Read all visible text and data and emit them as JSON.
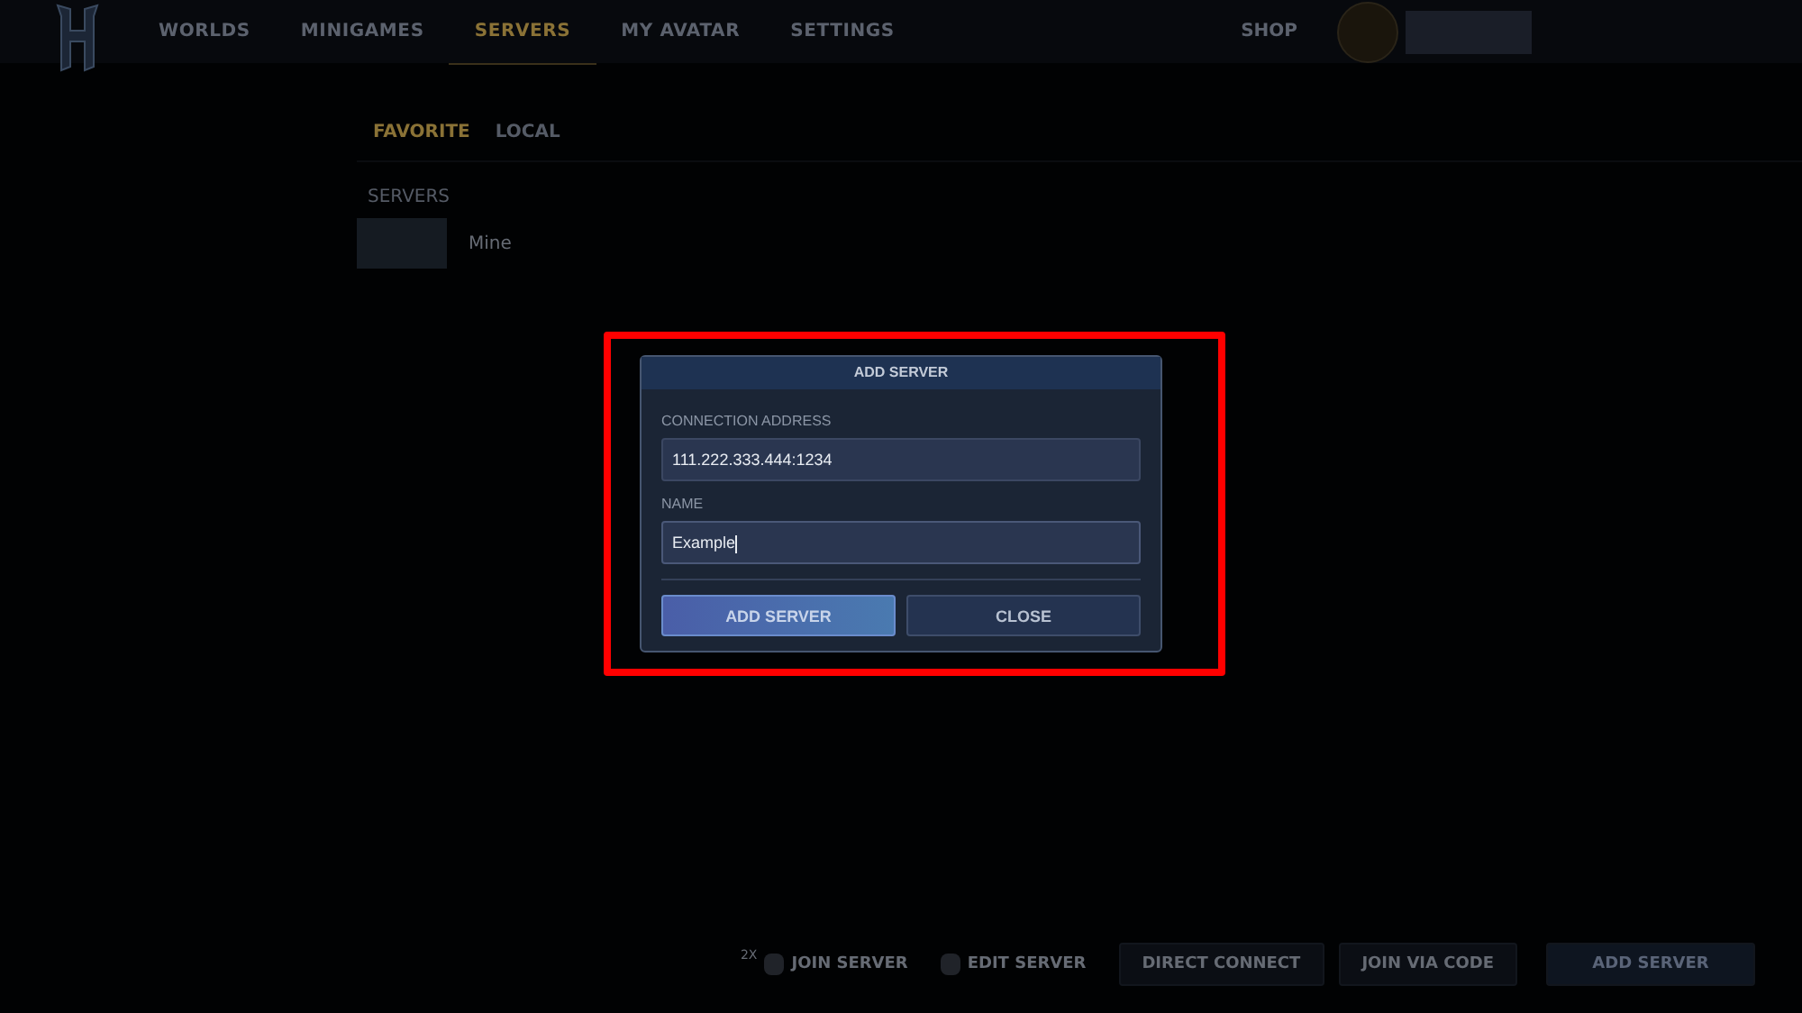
{
  "nav": {
    "items": [
      {
        "label": "WORLDS",
        "selected": false
      },
      {
        "label": "MINIGAMES",
        "selected": false
      },
      {
        "label": "SERVERS",
        "selected": true
      },
      {
        "label": "MY AVATAR",
        "selected": false
      },
      {
        "label": "SETTINGS",
        "selected": false
      }
    ],
    "shop": "SHOP"
  },
  "tabs": [
    {
      "label": "FAVORITE",
      "selected": true
    },
    {
      "label": "LOCAL",
      "selected": false
    }
  ],
  "section_label": "SERVERS",
  "servers": [
    {
      "name": "Mine"
    }
  ],
  "dialog": {
    "title": "ADD SERVER",
    "fields": [
      {
        "label": "CONNECTION ADDRESS",
        "value": "111.222.333.444:1234",
        "focused": false
      },
      {
        "label": "NAME",
        "value": "Example",
        "focused": true
      }
    ],
    "buttons": [
      {
        "label": "ADD SERVER",
        "kind": "primary"
      },
      {
        "label": "CLOSE",
        "kind": "secondary"
      }
    ]
  },
  "footer": [
    {
      "kind": "hint",
      "label": "JOIN SERVER",
      "key": "2X"
    },
    {
      "kind": "hint",
      "label": "EDIT SERVER"
    },
    {
      "kind": "button",
      "label": "DIRECT CONNECT"
    },
    {
      "kind": "button",
      "label": "JOIN VIA CODE"
    },
    {
      "kind": "primary",
      "label": "ADD SERVER"
    }
  ]
}
